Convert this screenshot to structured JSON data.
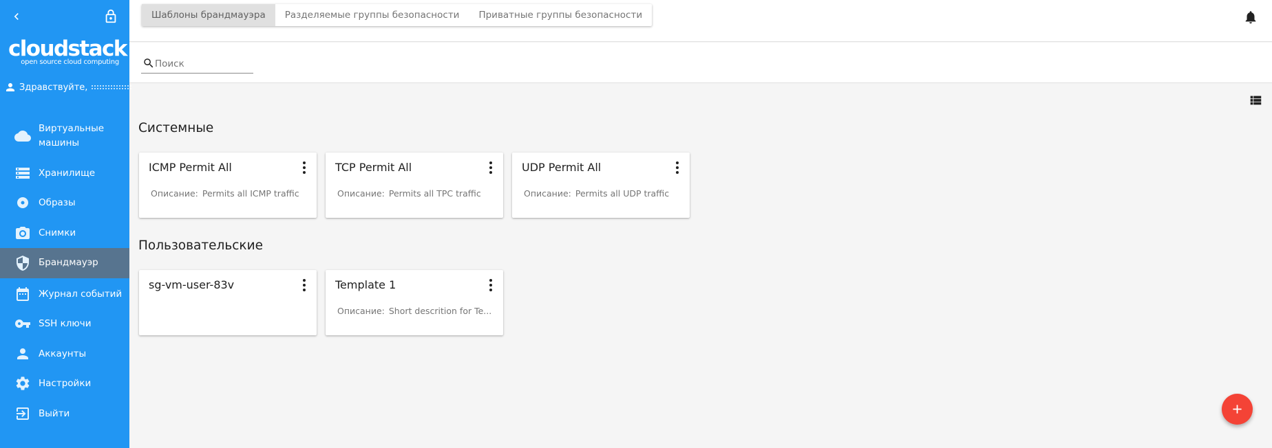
{
  "sidebar": {
    "logo_main": "cloudstack",
    "logo_sub": "open source cloud computing",
    "greeting": "Здравствуйте,",
    "items": [
      {
        "label": "Виртуальные машины",
        "icon": "cloud-icon"
      },
      {
        "label": "Хранилище",
        "icon": "storage-icon"
      },
      {
        "label": "Образы",
        "icon": "disc-icon"
      },
      {
        "label": "Снимки",
        "icon": "camera-icon"
      },
      {
        "label": "Брандмауэр",
        "icon": "shield-icon",
        "active": true
      },
      {
        "label": "Журнал событий",
        "icon": "calendar-icon"
      },
      {
        "label": "SSH ключи",
        "icon": "key-icon"
      },
      {
        "label": "Аккаунты",
        "icon": "person-icon"
      },
      {
        "label": "Настройки",
        "icon": "gear-icon"
      },
      {
        "label": "Выйти",
        "icon": "exit-icon"
      }
    ]
  },
  "tabs": [
    {
      "label": "Шаблоны брандмауэра",
      "active": true
    },
    {
      "label": "Разделяемые группы безопасности"
    },
    {
      "label": "Приватные группы безопасности"
    }
  ],
  "search": {
    "placeholder": "Поиск",
    "value": ""
  },
  "sections": {
    "system": {
      "title": "Системные",
      "cards": [
        {
          "title": "ICMP Permit All",
          "desc_label": "Описание:",
          "desc": "Permits all ICMP traffic"
        },
        {
          "title": "TCP Permit All",
          "desc_label": "Описание:",
          "desc": "Permits all TPC traffic"
        },
        {
          "title": "UDP Permit All",
          "desc_label": "Описание:",
          "desc": "Permits all UDP traffic"
        }
      ]
    },
    "custom": {
      "title": "Пользовательские",
      "cards": [
        {
          "title": "sg-vm-user-83v"
        },
        {
          "title": "Template 1",
          "desc_label": "Описание:",
          "desc": "Short descrition for Te..."
        }
      ]
    }
  },
  "colors": {
    "sidebar_bg": "#2196f3",
    "sidebar_active": "#5f6e7d",
    "fab": "#f44336"
  }
}
